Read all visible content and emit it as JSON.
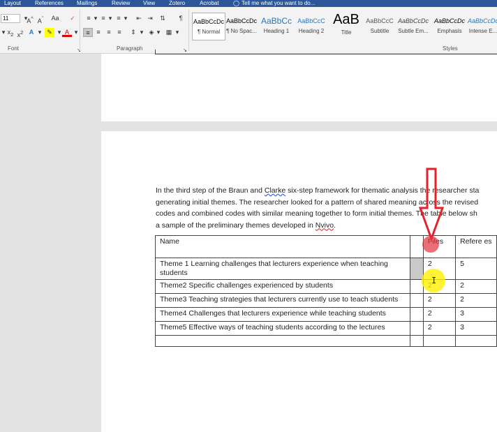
{
  "tabs": [
    "Layout",
    "References",
    "Mailings",
    "Review",
    "View",
    "Zotero",
    "Acrobat"
  ],
  "tell_me": "Tell me what you want to do...",
  "font": {
    "size": "11",
    "grow": "A^",
    "shrink": "Aˇ",
    "change_case": "Aa",
    "clear_format": "✂",
    "bold_row": [
      "x₂",
      "x²",
      "A",
      "aby",
      "A"
    ]
  },
  "groups": {
    "font": "Font",
    "paragraph": "Paragraph",
    "styles": "Styles"
  },
  "styles": [
    {
      "sample": "AaBbCcDc",
      "name": "¶ Normal",
      "color": "#000000"
    },
    {
      "sample": "AaBbCcDc",
      "name": "¶ No Spac...",
      "color": "#000000"
    },
    {
      "sample": "AaBbCc",
      "name": "Heading 1",
      "color": "#2e74b5"
    },
    {
      "sample": "AaBbCcC",
      "name": "Heading 2",
      "color": "#2e74b5"
    },
    {
      "sample": "AaB",
      "name": "Title",
      "color": "#000000"
    },
    {
      "sample": "AaBbCcC",
      "name": "Subtitle",
      "color": "#595959"
    },
    {
      "sample": "AaBbCcDc",
      "name": "Subtle Em...",
      "color": "#404040"
    },
    {
      "sample": "AaBbCcDc",
      "name": "Emphasis",
      "color": "#000000"
    },
    {
      "sample": "AaBbCcDc",
      "name": "Intense E...",
      "color": "#2e74b5"
    }
  ],
  "document": {
    "paragraph": {
      "l1a": "In the third step of the Braun and ",
      "l1b": "Clarke",
      "l1c": " six-step framework for thematic analysis the researcher sta",
      "l2": "generating initial themes. The researcher looked for a pattern of shared meaning across the revised",
      "l3": "codes and combined codes with similar meaning together to form initial themes. The table below sh",
      "l4a": "a sample of the preliminary themes developed in ",
      "l4b": "Nvivo",
      "l4c": "."
    },
    "table": {
      "headers": {
        "name": "Name",
        "col2": "",
        "files": "Files",
        "refs": "Refere es"
      },
      "rows": [
        {
          "name": "Theme 1 Learning challenges that lecturers experience when teaching students",
          "files": "2",
          "refs": "5"
        },
        {
          "name": "Theme2 Specific challenges experienced by students",
          "files": "2",
          "refs": "2"
        },
        {
          "name": "Theme3 Teaching strategies that lecturers currently use to teach students",
          "files": "2",
          "refs": "2"
        },
        {
          "name": "Theme4 Challenges that lecturers experience while teaching students",
          "files": "2",
          "refs": "3"
        },
        {
          "name": "Theme5 Effective ways of teaching students according to the lectures",
          "files": "2",
          "refs": "3"
        },
        {
          "name": "",
          "files": "",
          "refs": ""
        }
      ]
    }
  },
  "annotation_colors": {
    "arrow": "#e8202a",
    "click_red": "#e6323c",
    "cursor_yellow": "#fff000"
  }
}
